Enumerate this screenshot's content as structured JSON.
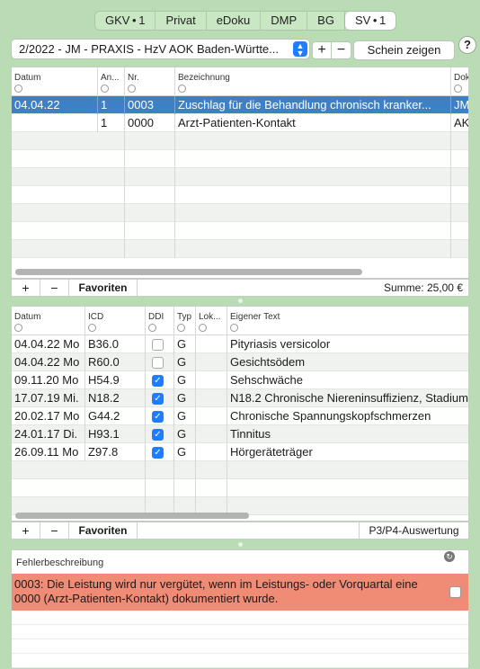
{
  "tabs": [
    {
      "label": "GKV • 1",
      "active": false
    },
    {
      "label": "Privat",
      "active": false
    },
    {
      "label": "eDoku",
      "active": false
    },
    {
      "label": "DMP",
      "active": false
    },
    {
      "label": "BG",
      "active": false
    },
    {
      "label": "SV • 1",
      "active": true
    }
  ],
  "schein": {
    "selected": "2/2022 - JM - PRAXIS - HzV AOK Baden-Württe...",
    "add_label": "+",
    "remove_label": "−",
    "show_button": "Schein zeigen",
    "help_label": "?"
  },
  "leistungen": {
    "headers": [
      "Datum",
      "An...",
      "Nr.",
      "Bezeichnung",
      "Dok"
    ],
    "rows": [
      {
        "datum": "04.04.22",
        "anzahl": "1",
        "nr": "0003",
        "bezeichnung": "Zuschlag für die Behandlung chronisch kranker...",
        "dok": "JM",
        "selected": true
      },
      {
        "datum": "",
        "anzahl": "1",
        "nr": "0000",
        "bezeichnung": "Arzt-Patienten-Kontakt",
        "dok": "AK",
        "selected": false
      }
    ],
    "footer": {
      "add": "+",
      "remove": "−",
      "favoriten": "Favoriten",
      "summe": "Summe: 25,00 €"
    }
  },
  "diagnosen": {
    "headers": [
      "Datum",
      "ICD",
      "DDI",
      "Typ",
      "Lok...",
      "Eigener Text"
    ],
    "rows": [
      {
        "datum": "04.04.22",
        "tag": "Mo",
        "icd": "B36.0",
        "ddi": false,
        "typ": "G",
        "text": "Pityriasis versicolor"
      },
      {
        "datum": "04.04.22",
        "tag": "Mo",
        "icd": "R60.0",
        "ddi": false,
        "typ": "G",
        "text": "Gesichtsödem"
      },
      {
        "datum": "09.11.20",
        "tag": "Mo",
        "icd": "H54.9",
        "ddi": true,
        "typ": "G",
        "text": "Sehschwäche"
      },
      {
        "datum": "17.07.19",
        "tag": "Mi.",
        "icd": "N18.2",
        "ddi": true,
        "typ": "G",
        "text": "N18.2 Chronische Niereninsuffizienz, Stadium"
      },
      {
        "datum": "20.02.17",
        "tag": "Mo",
        "icd": "G44.2",
        "ddi": true,
        "typ": "G",
        "text": "Chronische Spannungskopfschmerzen"
      },
      {
        "datum": "24.01.17",
        "tag": "Di.",
        "icd": "H93.1",
        "ddi": true,
        "typ": "G",
        "text": "Tinnitus"
      },
      {
        "datum": "26.09.11",
        "tag": "Mo",
        "icd": "Z97.8",
        "ddi": true,
        "typ": "G",
        "text": "Hörgeräteträger"
      }
    ],
    "footer": {
      "add": "+",
      "remove": "−",
      "favoriten": "Favoriten",
      "auswertung": "P3/P4-Auswertung"
    }
  },
  "fehler": {
    "title": "Fehlerbeschreibung",
    "message": "0003: Die Leistung wird nur vergütet, wenn im Leistungs- oder Vorquartal eine 0000 (Arzt-Patienten-Kontakt) dokumentiert wurde."
  },
  "colors": {
    "background": "#b9dcb4",
    "selection": "#3d80c6",
    "error": "#f08b75",
    "accent": "#1f7dff"
  }
}
